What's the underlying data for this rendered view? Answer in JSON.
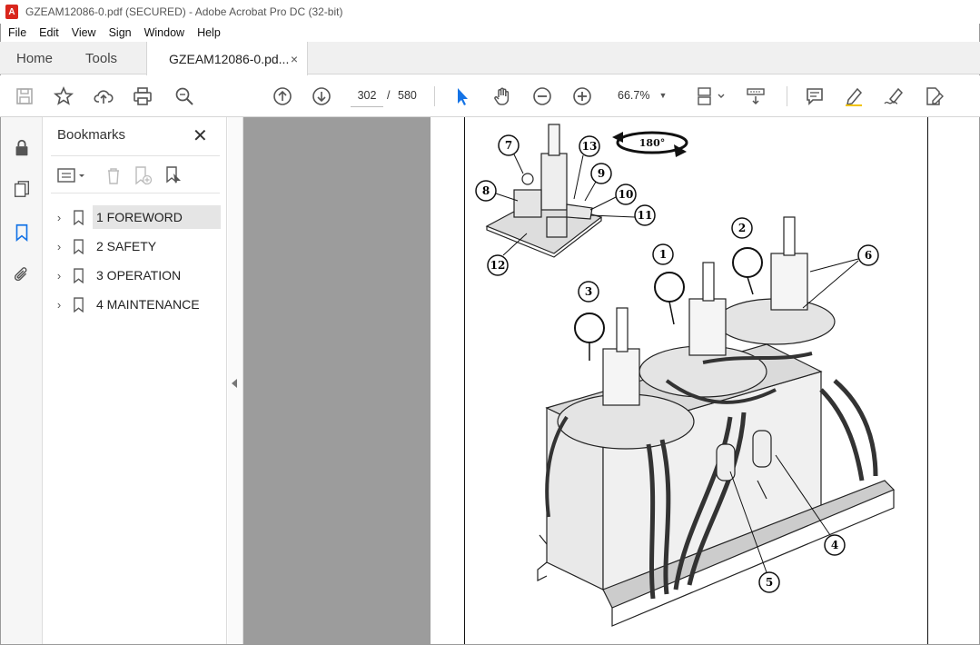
{
  "window": {
    "title": "GZEAM12086-0.pdf (SECURED) - Adobe Acrobat Pro DC (32-bit)"
  },
  "menu": [
    "File",
    "Edit",
    "View",
    "Sign",
    "Window",
    "Help"
  ],
  "tabs": {
    "home": "Home",
    "tools": "Tools",
    "document": "GZEAM12086-0.pd...",
    "close": "×"
  },
  "toolbar": {
    "page_current": "302",
    "page_sep": "/",
    "page_total": "580",
    "zoom": "66.7%"
  },
  "bookmarks": {
    "title": "Bookmarks",
    "close": "✕",
    "items": [
      {
        "label": "1 FOREWORD",
        "active": true
      },
      {
        "label": "2 SAFETY",
        "active": false
      },
      {
        "label": "3 OPERATION",
        "active": false
      },
      {
        "label": "4 MAINTENANCE",
        "active": false
      }
    ]
  },
  "document": {
    "rotation_label": "180°",
    "callouts": [
      "1",
      "2",
      "3",
      "4",
      "5",
      "6",
      "7",
      "8",
      "9",
      "10",
      "11",
      "12",
      "13"
    ]
  },
  "colors": {
    "accent": "#1473e6",
    "acrobat_red": "#d9261c",
    "doc_background": "#9c9c9c"
  }
}
